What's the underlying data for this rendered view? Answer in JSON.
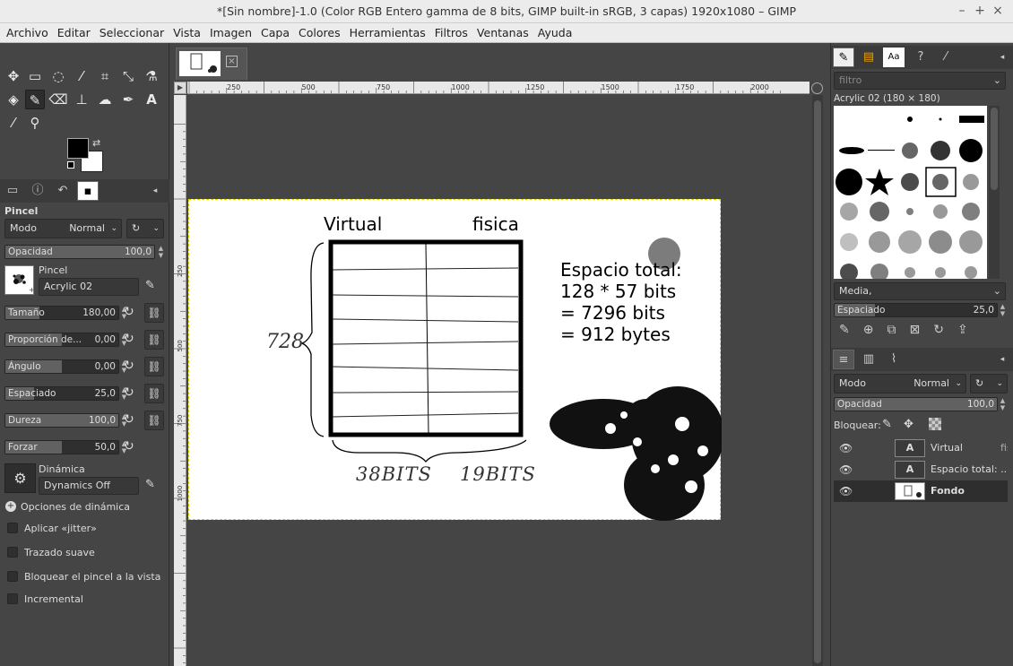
{
  "window": {
    "title": "*[Sin nombre]-1.0 (Color RGB Entero gamma de 8 bits, GIMP built-in sRGB, 3 capas) 1920x1080 – GIMP",
    "minimize": "–",
    "maximize": "+",
    "close": "×"
  },
  "menu": [
    "Archivo",
    "Editar",
    "Seleccionar",
    "Vista",
    "Imagen",
    "Capa",
    "Colores",
    "Herramientas",
    "Filtros",
    "Ventanas",
    "Ayuda"
  ],
  "tool_options": {
    "title": "Pincel",
    "mode_label": "Modo",
    "mode_value": "Normal",
    "opacity": {
      "label": "Opacidad",
      "value": "100,0",
      "fraction": 1.0
    },
    "brush_label": "Pincel",
    "brush_name": "Acrylic 02",
    "size": {
      "label": "Tamaño",
      "value": "180,00",
      "fraction": 0.3
    },
    "aspect": {
      "label": "Proporción de...",
      "value": "0,00",
      "fraction": 0.5
    },
    "angle": {
      "label": "Ángulo",
      "value": "0,00",
      "fraction": 0.5
    },
    "spacing": {
      "label": "Espaciado",
      "value": "25,0",
      "fraction": 0.25
    },
    "hardness": {
      "label": "Dureza",
      "value": "100,0",
      "fraction": 1.0
    },
    "force": {
      "label": "Forzar",
      "value": "50,0",
      "fraction": 0.5
    },
    "dynamics_label": "Dinámica",
    "dynamics_value": "Dynamics Off",
    "dynamics_options": "Opciones de dinámica",
    "jitter": "Aplicar «jitter»",
    "smooth": "Trazado suave",
    "lock_brush": "Bloquear el pincel a la vista",
    "incremental": "Incremental"
  },
  "rulers": {
    "h": [
      "250",
      "500",
      "750",
      "1000",
      "1250",
      "1500",
      "1750",
      "2000"
    ],
    "v": [
      "250",
      "500",
      "750",
      "1000"
    ]
  },
  "image_text": {
    "virtual": "Virtual",
    "fisica": "fisica",
    "line1": "Espacio total:",
    "line2": "128 * 57 bits",
    "line3": "= 7296 bits",
    "line4": "= 912 bytes",
    "hand_128": "728",
    "hand_38": "38BITS",
    "hand_19": "19BITS"
  },
  "brushes": {
    "filter_placeholder": "filtro",
    "current": "Acrylic 02 (180 × 180)",
    "tag": "Media,",
    "spacing_label": "Espaciado",
    "spacing_value": "25,0",
    "spacing_fraction": 0.25
  },
  "layers": {
    "mode_label": "Modo",
    "mode_value": "Normal",
    "opacity_label": "Opacidad",
    "opacity_value": "100,0",
    "opacity_fraction": 1.0,
    "lock_label": "Bloquear:",
    "items": [
      {
        "name": "Virtual",
        "extra": "fis"
      },
      {
        "name": "Espacio total: ..."
      },
      {
        "name": "Fondo"
      }
    ]
  }
}
